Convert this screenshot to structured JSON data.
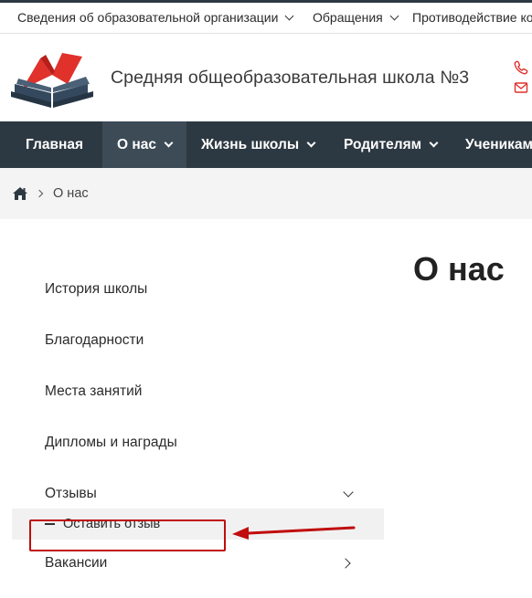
{
  "topbar": {
    "items": [
      {
        "label": "Сведения об образовательной организации"
      },
      {
        "label": "Обращения"
      },
      {
        "label": "Противодействие ко"
      }
    ]
  },
  "header": {
    "school_name": "Средняя общеобразовательная школа №3",
    "phone_icon": "phone-icon",
    "mail_icon": "envelope-icon",
    "accent_color": "#e0312b"
  },
  "nav": {
    "items": [
      {
        "label": "Главная",
        "has_dropdown": false
      },
      {
        "label": "О нас",
        "has_dropdown": true,
        "active": true
      },
      {
        "label": "Жизнь школы",
        "has_dropdown": true
      },
      {
        "label": "Родителям",
        "has_dropdown": true
      },
      {
        "label": "Ученикам",
        "has_dropdown": false
      }
    ],
    "background": "#2d3942"
  },
  "breadcrumb": {
    "home_icon": "home-icon",
    "current": "О нас"
  },
  "page": {
    "title": "О нас"
  },
  "side_menu": {
    "items": [
      {
        "label": "История школы"
      },
      {
        "label": "Благодарности"
      },
      {
        "label": "Места занятий"
      },
      {
        "label": "Дипломы и награды"
      },
      {
        "label": "Отзывы",
        "expanded": true
      },
      {
        "label": "Оставить отзыв",
        "submenu": true
      },
      {
        "label": "Вакансии",
        "has_children": true
      }
    ]
  },
  "annotation": {
    "color": "#c00d0d"
  }
}
